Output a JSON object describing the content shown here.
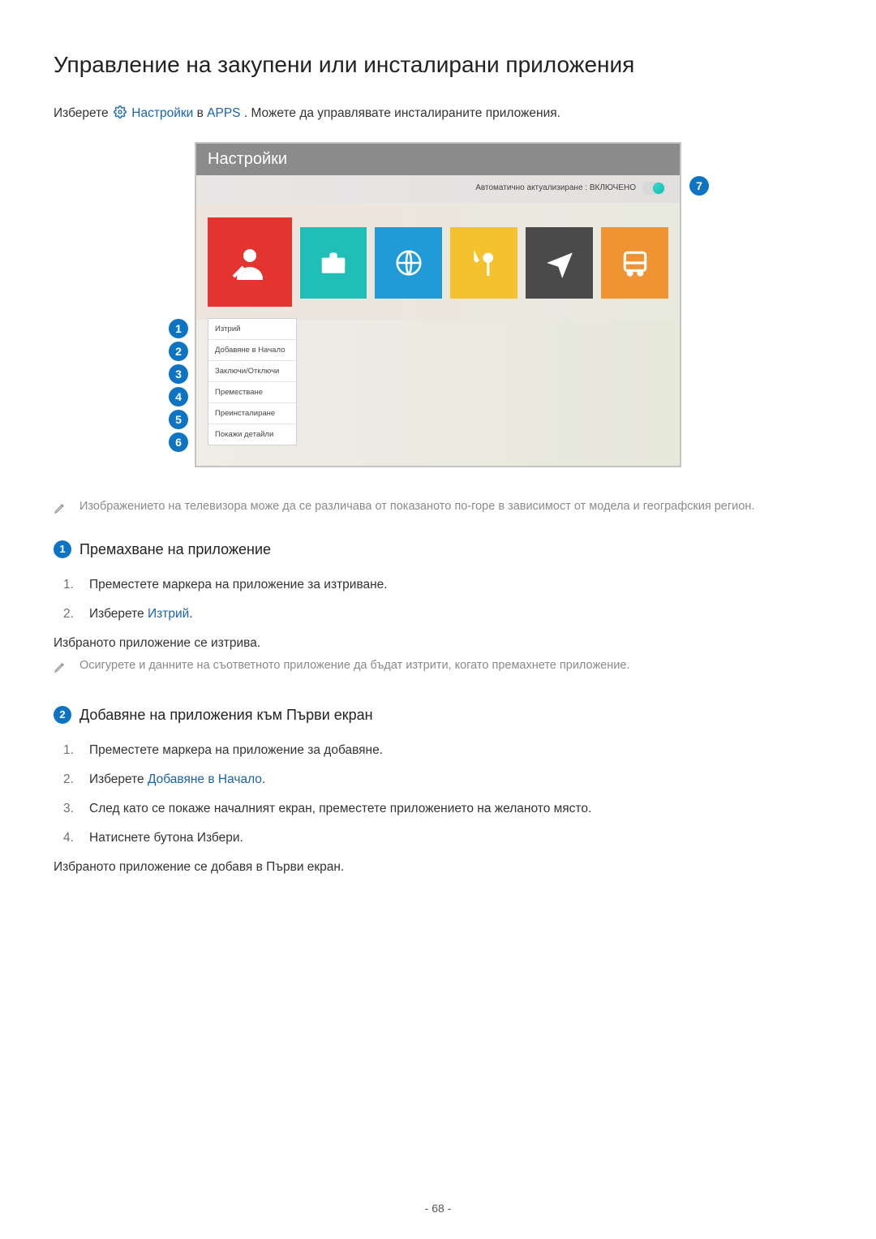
{
  "title": "Управление на закупени или инсталирани приложения",
  "intro": {
    "prefix": "Изберете ",
    "link1": "Настройки",
    "middle": " в ",
    "link2": "APPS",
    "suffix": ". Можете да управлявате инсталираните приложения."
  },
  "screenshot": {
    "header": "Настройки",
    "auto_update": "Автоматично актуализиране : ВКЛЮЧЕНО",
    "context_menu": [
      "Изтрий",
      "Добавяне в Начало",
      "Заключи/Отключи",
      "Преместване",
      "Преинсталиране",
      "Покажи детайли"
    ],
    "callouts": {
      "c1": "1",
      "c2": "2",
      "c3": "3",
      "c4": "4",
      "c5": "5",
      "c6": "6",
      "c7": "7"
    }
  },
  "note1": "Изображението на телевизора може да се различава от показаното по-горе в зависимост от модела и географския регион.",
  "section1": {
    "num": "1",
    "title": "Премахване на приложение",
    "steps": [
      {
        "n": "1.",
        "text": "Преместете маркера на приложение за изтриване."
      },
      {
        "n": "2.",
        "prefix": "Изберете ",
        "link": "Изтрий",
        "suffix": "."
      }
    ],
    "result": "Избраното приложение се изтрива.",
    "note": "Осигурете и данните на съответното приложение да бъдат изтрити, когато премахнете приложение."
  },
  "section2": {
    "num": "2",
    "title": "Добавяне на приложения към Първи екран",
    "steps": [
      {
        "n": "1.",
        "text": "Преместете маркера на приложение за добавяне."
      },
      {
        "n": "2.",
        "prefix": "Изберете ",
        "link": "Добавяне в Начало",
        "suffix": "."
      },
      {
        "n": "3.",
        "text": "След като се покаже началният екран, преместете приложението на желаното място."
      },
      {
        "n": "4.",
        "text": "Натиснете бутона Избери."
      }
    ],
    "result": "Избраното приложение се добавя в Първи екран."
  },
  "page_number": "- 68 -"
}
